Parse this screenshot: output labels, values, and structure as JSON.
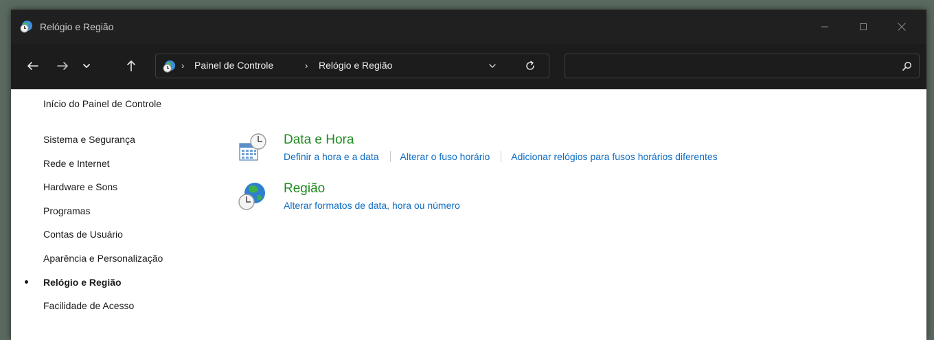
{
  "window": {
    "title": "Relógio e Região"
  },
  "address_bar": {
    "crumbs": [
      "Painel de Controle",
      "Relógio e Região"
    ],
    "separator": "›"
  },
  "search": {
    "value": "",
    "placeholder": ""
  },
  "sidebar": {
    "home_label": "Início do Painel de Controle",
    "items": [
      {
        "label": "Sistema e Segurança"
      },
      {
        "label": "Rede e Internet"
      },
      {
        "label": "Hardware e Sons"
      },
      {
        "label": "Programas"
      },
      {
        "label": "Contas de Usuário"
      },
      {
        "label": "Aparência e Personalização"
      },
      {
        "label": "Relógio e Região",
        "active": true
      },
      {
        "label": "Facilidade de Acesso"
      }
    ]
  },
  "categories": [
    {
      "title": "Data e Hora",
      "links": [
        "Definir a hora e a data",
        "Alterar o fuso horário",
        "Adicionar relógios para fusos horários diferentes"
      ]
    },
    {
      "title": "Região",
      "links": [
        "Alterar formatos de data, hora ou número"
      ]
    }
  ],
  "colors": {
    "titlebar_bg": "#202020",
    "category_title": "#1e8a1e",
    "link": "#0f6dc4"
  },
  "icons": {
    "app": "control-panel-clock-globe-icon",
    "back": "arrow-left-icon",
    "forward": "arrow-right-icon",
    "recent": "chevron-down-icon",
    "up": "arrow-up-icon",
    "refresh": "refresh-icon",
    "search": "search-icon",
    "minimize": "minimize-icon",
    "maximize": "maximize-icon",
    "close": "close-icon"
  }
}
